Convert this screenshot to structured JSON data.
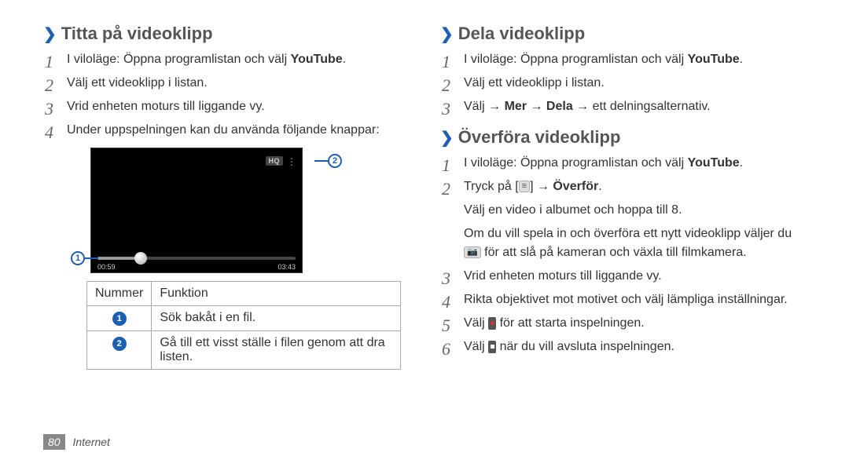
{
  "left": {
    "title": "Titta på videoklipp",
    "steps": {
      "s1a": "I viloläge: Öppna programlistan och välj ",
      "s1b": "YouTube",
      "s1c": ".",
      "s2": "Välj ett videoklipp i listan.",
      "s3": "Vrid enheten moturs till liggande vy.",
      "s4": "Under uppspelningen kan du använda följande knappar:"
    },
    "player": {
      "hq": "HQ",
      "t_left": "00:59",
      "t_right": "03:43"
    },
    "table": {
      "h1": "Nummer",
      "h2": "Funktion",
      "r1": "Sök bakåt i en fil.",
      "r2": "Gå till ett visst ställe i filen genom att dra listen."
    }
  },
  "right": {
    "sec1": {
      "title": "Dela videoklipp",
      "s1a": "I viloläge: Öppna programlistan och välj ",
      "s1b": "YouTube",
      "s1c": ".",
      "s2": "Välj ett videoklipp i listan.",
      "s3a": "Välj → ",
      "s3b": "Mer",
      "s3c": " → ",
      "s3d": "Dela",
      "s3e": " → ett delningsalternativ."
    },
    "sec2": {
      "title": "Överföra videoklipp",
      "s1a": "I viloläge: Öppna programlistan och välj ",
      "s1b": "YouTube",
      "s1c": ".",
      "s2a": "Tryck på [",
      "s2b": "] → ",
      "s2c": "Överför",
      "s2d": ".",
      "sub1": "Välj en video i albumet och hoppa till 8.",
      "sub2a": "Om du vill spela in och överföra ett nytt videoklipp väljer du ",
      "sub2b": " för att slå på kameran och växla till filmkamera.",
      "s3": "Vrid enheten moturs till liggande vy.",
      "s4": "Rikta objektivet mot motivet och välj lämpliga inställningar.",
      "s5a": "Välj ",
      "s5b": " för att starta inspelningen.",
      "s6a": "Välj ",
      "s6b": " när du vill avsluta inspelningen."
    }
  },
  "footer": {
    "page": "80",
    "section": "Internet"
  }
}
